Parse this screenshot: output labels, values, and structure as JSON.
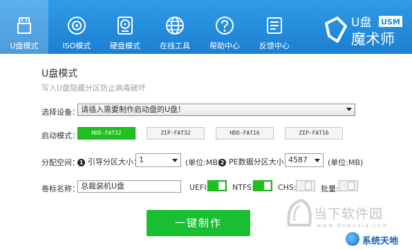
{
  "nav": {
    "items": [
      {
        "label": "U盘模式",
        "icon": "usb-drive-icon",
        "active": true
      },
      {
        "label": "ISO模式",
        "icon": "disc-icon",
        "active": false
      },
      {
        "label": "硬盘模式",
        "icon": "hard-disk-icon",
        "active": false
      },
      {
        "label": "在线工具",
        "icon": "globe-icon",
        "active": false
      },
      {
        "label": "帮助中心",
        "icon": "help-icon",
        "active": false
      },
      {
        "label": "反馈中心",
        "icon": "feedback-icon",
        "active": false
      }
    ],
    "brand": {
      "line1": "U盘",
      "badge": "USM",
      "line2": "魔术师"
    }
  },
  "header": {
    "title": "U盘模式",
    "subtitle": "写入U盘隐藏分区防止病毒破坏"
  },
  "device": {
    "label": "选择设备：",
    "value": "请插入需要制作启动盘的U盘！"
  },
  "boot_mode": {
    "label": "启动模式：",
    "options": [
      "HDD-FAT32",
      "ZIP-FAT32",
      "HDD-FAT16",
      "ZIP-FAT16"
    ],
    "selected": "HDD-FAT32"
  },
  "partition": {
    "label": "分配空间：",
    "boot_num": "1",
    "boot_label": "引导分区大小：",
    "boot_value": "1",
    "unit1": "(单位:MB)",
    "pe_num": "2",
    "pe_label": "PE数据分区大小：",
    "pe_value": "4587",
    "unit2": "(单位:MB)"
  },
  "volume": {
    "label": "卷标名称：",
    "value": "总裁装机U盘",
    "toggles": [
      {
        "label": "UEFI:",
        "on": true
      },
      {
        "label": "NTFS:",
        "on": true
      },
      {
        "label": "CHS:",
        "on": false
      },
      {
        "label": "批量:",
        "on": false
      }
    ]
  },
  "actions": {
    "make_label": "一键制作"
  },
  "watermarks": {
    "site1": "当下软件园",
    "site1_sub": "www.downxia.com",
    "site2": "系统天地"
  },
  "colors": {
    "topbar": "#1f88dc",
    "accent_green": "#1ec21e",
    "button_green": "#18bf30"
  }
}
